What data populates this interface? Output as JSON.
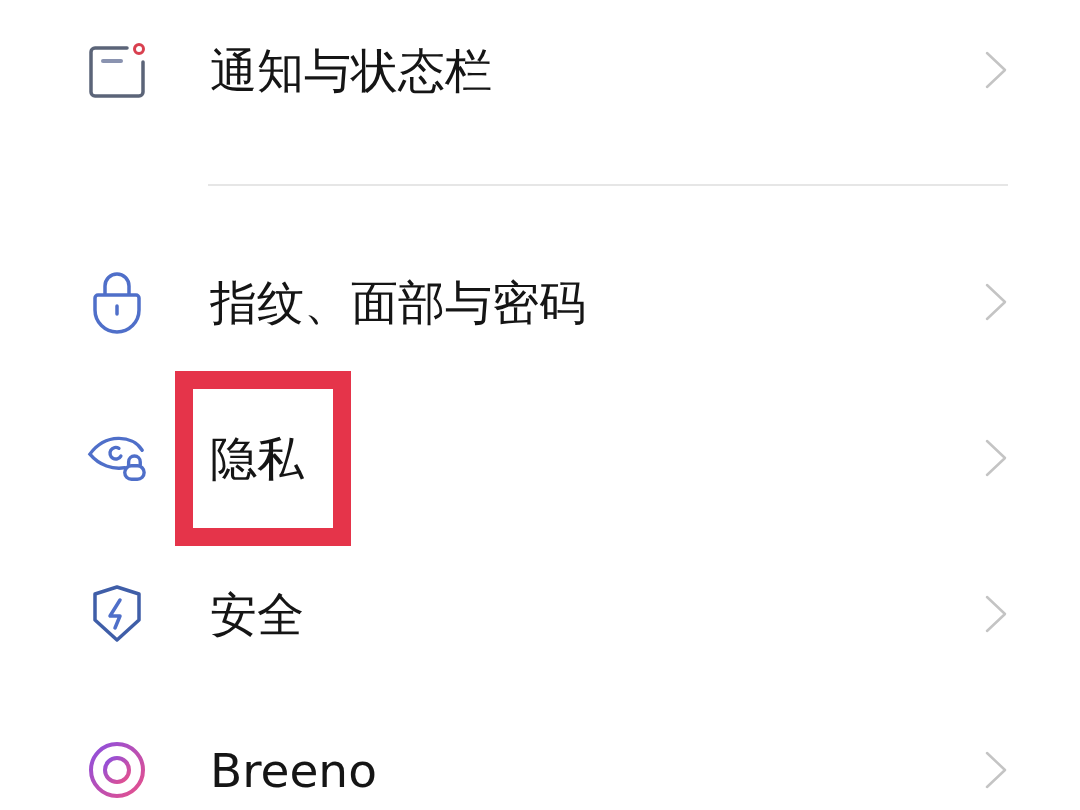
{
  "settings_groups": [
    {
      "items": [
        {
          "kind": "notification",
          "label": "通知与状态栏",
          "highlighted": false
        }
      ]
    },
    {
      "items": [
        {
          "kind": "lock",
          "label": "指纹、面部与密码",
          "highlighted": false
        },
        {
          "kind": "privacy",
          "label": "隐私",
          "highlighted": true
        },
        {
          "kind": "shield",
          "label": "安全",
          "highlighted": false
        },
        {
          "kind": "assistant",
          "label": "Breeno",
          "highlighted": false
        }
      ]
    }
  ]
}
